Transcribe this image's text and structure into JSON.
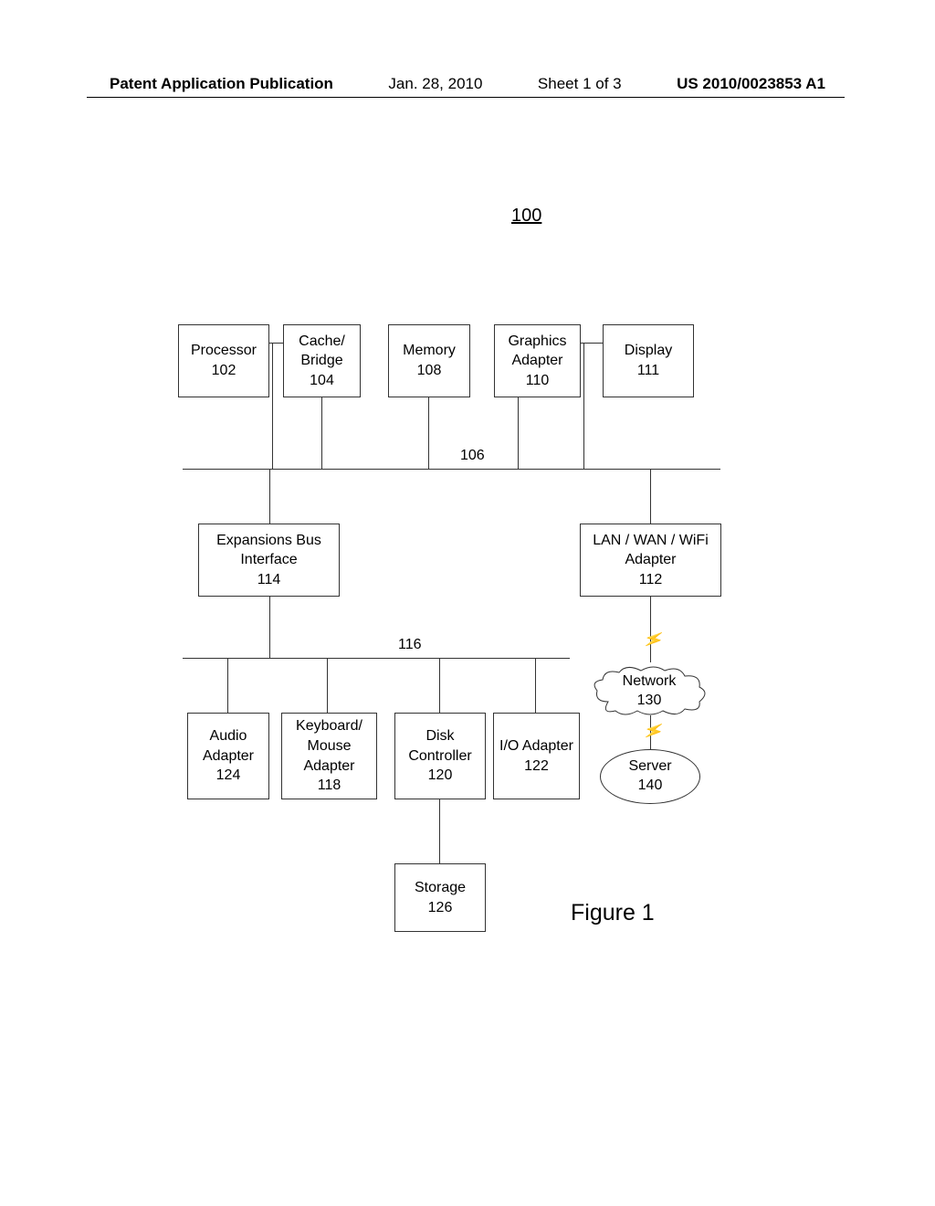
{
  "header": {
    "pub_label": "Patent Application Publication",
    "date": "Jan. 28, 2010",
    "sheet": "Sheet 1 of 3",
    "pub_number": "US 2010/0023853 A1"
  },
  "system_ref": "100",
  "bus_labels": {
    "bus106": "106",
    "bus116": "116"
  },
  "figure_label": "Figure 1",
  "boxes": {
    "processor": {
      "name": "Processor",
      "ref": "102"
    },
    "cache": {
      "name": "Cache/\nBridge",
      "ref": "104"
    },
    "memory": {
      "name": "Memory",
      "ref": "108"
    },
    "graphics": {
      "name": "Graphics\nAdapter",
      "ref": "110"
    },
    "display": {
      "name": "Display",
      "ref": "111"
    },
    "expbus": {
      "name": "Expansions Bus\nInterface",
      "ref": "114"
    },
    "lanwan": {
      "name": "LAN / WAN / WiFi\nAdapter",
      "ref": "112"
    },
    "audio": {
      "name": "Audio\nAdapter",
      "ref": "124"
    },
    "kbm": {
      "name": "Keyboard/\nMouse\nAdapter",
      "ref": "118"
    },
    "disk": {
      "name": "Disk\nController",
      "ref": "120"
    },
    "ioa": {
      "name": "I/O Adapter",
      "ref": "122"
    },
    "storage": {
      "name": "Storage",
      "ref": "126"
    },
    "network": {
      "name": "Network",
      "ref": "130"
    },
    "server": {
      "name": "Server",
      "ref": "140"
    }
  }
}
